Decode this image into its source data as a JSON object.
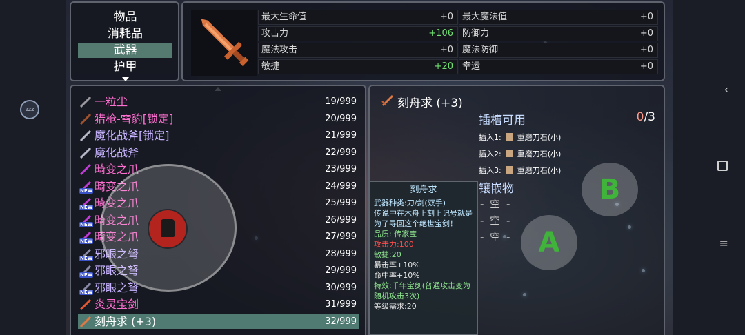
{
  "categories": [
    {
      "label": "物品",
      "selected": false
    },
    {
      "label": "消耗品",
      "selected": false
    },
    {
      "label": "武器",
      "selected": true
    },
    {
      "label": "护甲",
      "selected": false
    }
  ],
  "stats": [
    {
      "label": "最大生命值",
      "value": "+0",
      "highlight": false
    },
    {
      "label": "最大魔法值",
      "value": "+0",
      "highlight": false
    },
    {
      "label": "攻击力",
      "value": "+106",
      "highlight": true
    },
    {
      "label": "防御力",
      "value": "+0",
      "highlight": false
    },
    {
      "label": "魔法攻击",
      "value": "+0",
      "highlight": false
    },
    {
      "label": "魔法防御",
      "value": "+0",
      "highlight": false
    },
    {
      "label": "敏捷",
      "value": "+20",
      "highlight": true
    },
    {
      "label": "幸运",
      "value": "+0",
      "highlight": false
    }
  ],
  "inventory": [
    {
      "name": "一粒尘",
      "count": "19/999",
      "color": "pink",
      "new": false,
      "icon": "dust-icon",
      "selected": false
    },
    {
      "name": "猎枪-雪豹[锁定]",
      "count": "20/999",
      "color": "pink",
      "new": false,
      "icon": "gun-icon",
      "selected": false
    },
    {
      "name": "魔化战斧[锁定]",
      "count": "21/999",
      "color": "blue",
      "new": false,
      "icon": "axe-icon",
      "selected": false
    },
    {
      "name": "魔化战斧",
      "count": "22/999",
      "color": "blue",
      "new": false,
      "icon": "axe-icon",
      "selected": false
    },
    {
      "name": "畸变之爪",
      "count": "23/999",
      "color": "pink",
      "new": false,
      "icon": "claw-icon",
      "selected": false
    },
    {
      "name": "畸变之爪",
      "count": "24/999",
      "color": "pink",
      "new": true,
      "icon": "claw-icon",
      "selected": false
    },
    {
      "name": "畸变之爪",
      "count": "25/999",
      "color": "pink",
      "new": true,
      "icon": "claw-icon",
      "selected": false
    },
    {
      "name": "畸变之爪",
      "count": "26/999",
      "color": "pink",
      "new": true,
      "icon": "claw-icon",
      "selected": false
    },
    {
      "name": "畸变之爪",
      "count": "27/999",
      "color": "pink",
      "new": true,
      "icon": "claw-icon",
      "selected": false
    },
    {
      "name": "邪眼之弩",
      "count": "28/999",
      "color": "blue",
      "new": true,
      "icon": "crossbow-icon",
      "selected": false
    },
    {
      "name": "邪眼之弩",
      "count": "29/999",
      "color": "blue",
      "new": true,
      "icon": "crossbow-icon",
      "selected": false
    },
    {
      "name": "邪眼之弩",
      "count": "30/999",
      "color": "blue",
      "new": true,
      "icon": "crossbow-icon",
      "selected": false
    },
    {
      "name": "炎灵宝剑",
      "count": "31/999",
      "color": "pink",
      "new": false,
      "icon": "fire-sword-icon",
      "selected": false
    },
    {
      "name": "刻舟求 (+3)",
      "count": "32/999",
      "color": "pink",
      "new": false,
      "icon": "sword-icon",
      "selected": true
    }
  ],
  "new_badge": "NEW",
  "detail": {
    "title": "刻舟求 (+3)",
    "socket_header": "插槽可用",
    "socket_used": "0",
    "socket_total": "/3",
    "sockets": [
      {
        "label": "插入1:",
        "stone": "重磨刀石(小)"
      },
      {
        "label": "插入2:",
        "stone": "重磨刀石(小)"
      },
      {
        "label": "插入3:",
        "stone": "重磨刀石(小)"
      }
    ],
    "inlay_header": "镶嵌物",
    "inlays": [
      "- 空 -",
      "- 空 -",
      "- 空 -"
    ]
  },
  "tooltip": {
    "name": "刻舟求",
    "lines": [
      {
        "text": "武器种类:刀/剑(双手)",
        "style": "b"
      },
      {
        "text": "传说中在木舟上刻上记号就是为了寻回这个绝世宝剑！",
        "style": "b"
      },
      {
        "text": "品质: 传家宝",
        "style": "g"
      },
      {
        "text": "攻击力:100",
        "style": "r"
      },
      {
        "text": "敏捷:20",
        "style": "g"
      },
      {
        "text": "暴击率+10%",
        "style": "w"
      },
      {
        "text": "命中率+10%",
        "style": "w"
      },
      {
        "text": "特效:千年宝剑(普通攻击变为随机攻击3次)",
        "style": "g"
      },
      {
        "text": "等级需求:20",
        "style": "w"
      }
    ]
  },
  "controls": {
    "a_label": "A",
    "b_label": "B"
  },
  "status_icon": "zzz",
  "nav": {
    "back": "‹",
    "menu": "≡"
  }
}
